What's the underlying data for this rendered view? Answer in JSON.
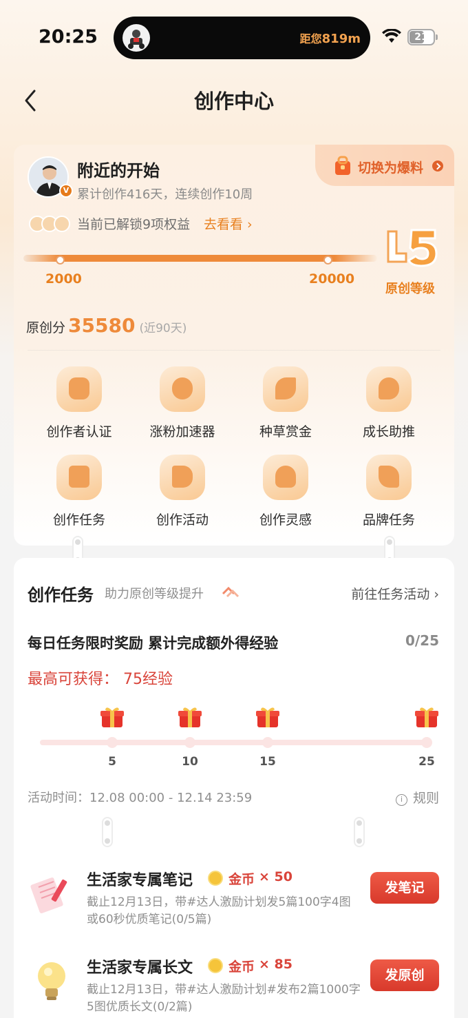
{
  "status_bar": {
    "time": "20:25",
    "island_prefix": "距您",
    "island_distance": "819m",
    "battery": "21"
  },
  "header": {
    "title": "创作中心"
  },
  "profile": {
    "username": "附近的开始",
    "stats": "累计创作416天，连续创作10周",
    "switch_label": "切换为爆料",
    "benefits_text": "当前已解锁9项权益",
    "benefits_link": "去看看 ›",
    "progress": {
      "start": "2000",
      "end": "20000"
    },
    "level_label": "原创等级",
    "score_label": "原创分",
    "score_value": "35580",
    "score_note": "(近90天)"
  },
  "tools": [
    {
      "label": "创作者认证",
      "icon": "verify-icon"
    },
    {
      "label": "涨粉加速器",
      "icon": "fans-boost-icon"
    },
    {
      "label": "种草赏金",
      "icon": "seedling-icon"
    },
    {
      "label": "成长助推",
      "icon": "growth-icon"
    },
    {
      "label": "创作任务",
      "icon": "task-clipboard-icon"
    },
    {
      "label": "创作活动",
      "icon": "flag-icon"
    },
    {
      "label": "创作灵感",
      "icon": "lightbulb-icon"
    },
    {
      "label": "品牌任务",
      "icon": "brand-tag-icon"
    }
  ],
  "task_section": {
    "title": "创作任务",
    "subtitle": "助力原创等级提升",
    "link": "前往任务活动 ›",
    "daily_title": "每日任务限时奖励 累计完成额外得经验",
    "daily_count": "0/25",
    "daily_max": "最高可获得： 75经验",
    "milestones": [
      "5",
      "10",
      "15",
      "25"
    ],
    "activity_time": "活动时间：12.08 00:00 - 12.14 23:59",
    "rules": "规则",
    "tasks": [
      {
        "name": "生活家专属笔记",
        "reward_label": "金币",
        "reward_mult": "× 50",
        "desc": "截止12月13日，带#达人激励计划发5篇100字4图或60秒优质笔记(0/5篇)",
        "button": "发笔记"
      },
      {
        "name": "生活家专属长文",
        "reward_label": "金币",
        "reward_mult": "× 85",
        "desc": "截止12月13日，带#达人激励计划#发布2篇1000字5图优质长文(0/2篇)",
        "button": "发原创"
      }
    ]
  },
  "colors": {
    "accent_orange": "#ee8a3a",
    "accent_red": "#d9443a"
  }
}
